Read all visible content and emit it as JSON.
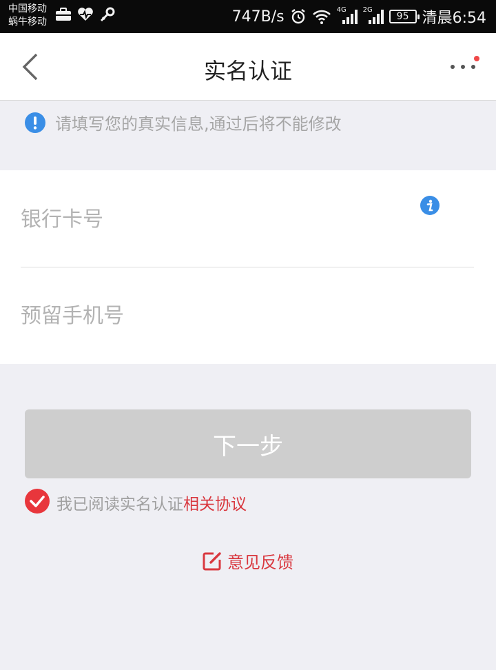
{
  "status_bar": {
    "carrier_1": "中国移动",
    "carrier_2": "蜗牛移动",
    "net_speed": "747B/s",
    "signal_1_type": "4G",
    "signal_2_type": "2G",
    "battery": "95",
    "time": "清晨6:54"
  },
  "nav": {
    "title": "实名认证"
  },
  "notice": {
    "text": "请填写您的真实信息,通过后将不能修改"
  },
  "form": {
    "bank_card_placeholder": "银行卡号",
    "bank_card_value": "",
    "phone_placeholder": "预留手机号",
    "phone_value": ""
  },
  "next_button": {
    "label": "下一步"
  },
  "agreement": {
    "text": "我已阅读实名认证",
    "link": "相关协议",
    "checked": true
  },
  "feedback": {
    "label": "意见反馈"
  },
  "colors": {
    "accent_red": "#d9383f",
    "info_blue": "#3a8ee6",
    "button_disabled": "#cecece"
  }
}
